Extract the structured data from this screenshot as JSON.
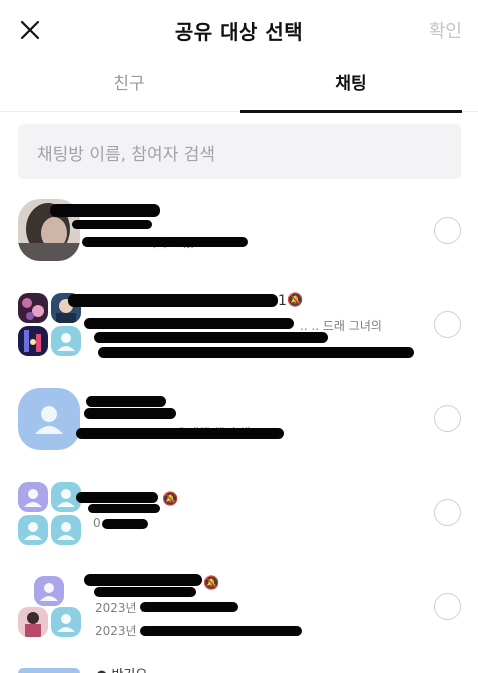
{
  "header": {
    "title": "공유 대상 선택",
    "confirm_label": "확인"
  },
  "tabs": [
    {
      "label": "친구",
      "active": false
    },
    {
      "label": "채팅",
      "active": true
    }
  ],
  "search": {
    "placeholder": "채팅방 이름, 참여자 검색"
  },
  "chat_rooms": [
    {
      "avatar": "photo",
      "selected": false,
      "preview_fragment": "..  ..  ..  .. ..이라고 했..  .."
    },
    {
      "avatar": "group-photos",
      "selected": false,
      "muted": true,
      "name_fragment": "1",
      "preview_fragment": "..  .. 드래 그녀의"
    },
    {
      "avatar": "default-profile",
      "selected": false,
      "preview_fragment": ".. .. 에 대해 했던 채"
    },
    {
      "avatar": "group-default",
      "selected": false,
      "muted": true,
      "preview_fragment": "0"
    },
    {
      "avatar": "group-mixed",
      "selected": false,
      "muted": true,
      "time_fragment": "2023년 ..",
      "time_fragment_2": "2023년 .."
    }
  ],
  "bottom_fragment": "● 반기으~",
  "colors": {
    "profile_blue": "#a2c4ec",
    "profile_purple": "#a9a6ea",
    "profile_teal": "#8ccfe2",
    "radio_border": "#cfcfd2",
    "search_bg": "#f3f3f5",
    "confirm_disabled": "#c4c4c4"
  },
  "icons": {
    "close": "close-icon",
    "radio": "radio-unchecked-icon",
    "mute": "bell-off-icon",
    "person": "person-icon"
  }
}
